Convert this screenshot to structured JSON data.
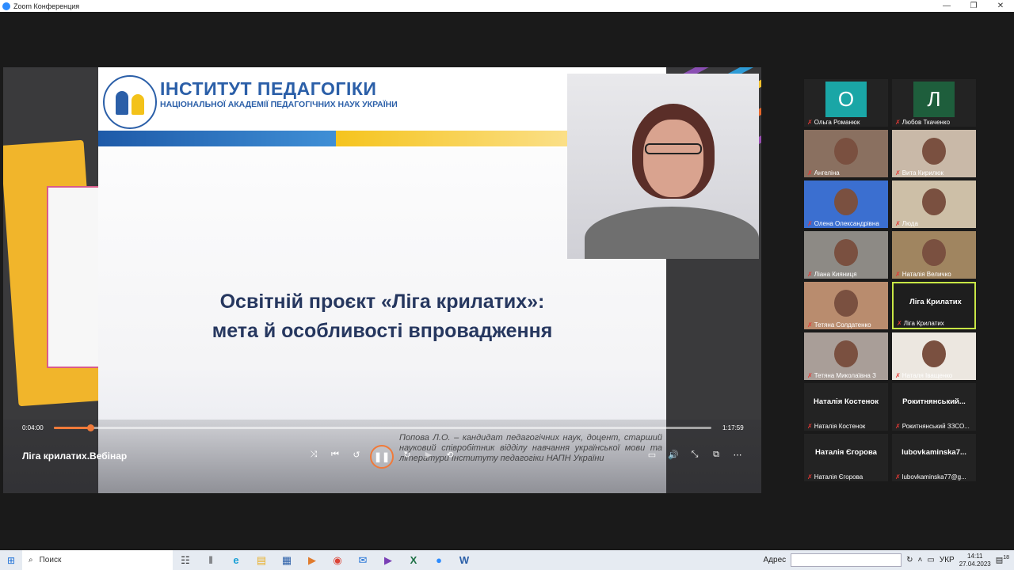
{
  "window": {
    "title": "Zoom Конференция",
    "controls": [
      "—",
      "❐",
      "✕"
    ]
  },
  "slide": {
    "institute_title": "ІНСТИТУТ ПЕДАГОГІКИ",
    "institute_subtitle": "НАЦІОНАЛЬНОЇ АКАДЕМІЇ ПЕДАГОГІЧНИХ НАУК УКРАЇНИ",
    "title_line1": "Освітній проєкт «Ліга крилатих»:",
    "title_line2": "мета й особливості впровадження",
    "author": "Попова Л.О. – кандидат педагогічних наук, доцент, старший науковий співробітник відділу навчання української мови та літератури Інституту педагогіки НАПН України"
  },
  "player": {
    "current_time": "0:04:00",
    "total_time": "1:17:59",
    "progress_fraction": 0.056,
    "video_title": "Ліга крилатих.Вебінар",
    "accent_color": "#f07a3a",
    "controls": {
      "shuffle": "⤨",
      "prev": "⏮",
      "rewind": "↺",
      "play_pause": "❚❚",
      "forward": "↻",
      "next": "▶",
      "repeat": "⟲",
      "subtitles": "▭",
      "volume": "🔊",
      "collapse": "⤡",
      "miniplayer": "⧉",
      "more": "⋯"
    }
  },
  "gallery": {
    "participants": [
      {
        "name": "Ольга Романюк",
        "avatar_letter": "О",
        "avatar_color": "#1aa6a6"
      },
      {
        "name": "Любов Ткаченко",
        "avatar_letter": "Л",
        "avatar_color": "#1e5e3c"
      },
      {
        "name": "Ангеліна"
      },
      {
        "name": "Вита Кирилюк"
      },
      {
        "name": "Олена Олександрівна"
      },
      {
        "name": "Люда"
      },
      {
        "name": "Ліана Кияниця"
      },
      {
        "name": "Наталія Величко"
      },
      {
        "name": "Тетяна Солдатенко"
      },
      {
        "name": "Ліга Крилатих",
        "display_name": "Ліга Крилатих"
      },
      {
        "name": "Тетяна Миколаївна З"
      },
      {
        "name": "Наталя Іващенко"
      },
      {
        "name": "Наталія Костенок",
        "display_name": "Наталія Костенок"
      },
      {
        "name": "Рокитнянський ЗЗСО...",
        "display_name": "Рокитнянський..."
      },
      {
        "name": "Наталія Єгорова",
        "display_name": "Наталія Єгорова"
      },
      {
        "name": "lubovkaminska77@g...",
        "display_name": "lubovkaminska7..."
      }
    ],
    "muted_icon": "✗"
  },
  "taskbar": {
    "start_icon": "windows-icon",
    "search_label": "Поиск",
    "apps": [
      "☷",
      "‖",
      "e",
      "▤",
      "▦",
      "▶",
      "◉",
      "✉",
      "▶",
      "X",
      "●",
      "W"
    ],
    "address_label": "Адрес",
    "lang": "УКР",
    "time": "14:11",
    "date": "27.04.2023",
    "notif_count": "18"
  }
}
